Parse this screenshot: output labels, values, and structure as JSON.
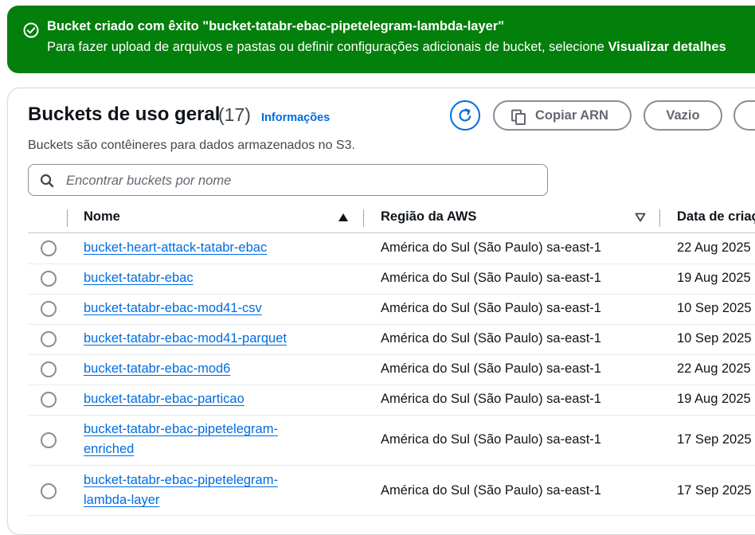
{
  "flash": {
    "title": "Bucket criado com êxito \"bucket-tatabr-ebac-pipetelegram-lambda-layer\"",
    "body_prefix": "Para fazer upload de arquivos e pastas ou definir configurações adicionais de bucket, selecione ",
    "body_bold": "Visualizar detalhes",
    "icon": "check-circle-icon",
    "color": "#037f0c"
  },
  "header": {
    "title": "Buckets de uso geral",
    "count": "(17)",
    "info_link": "Informações",
    "description": "Buckets são contêineres para dados armazenados no S3."
  },
  "actions": {
    "refresh_icon": "refresh-icon",
    "copy_arn": "Copiar ARN",
    "copy_icon": "copy-icon",
    "empty": "Vazio"
  },
  "search": {
    "placeholder": "Encontrar buckets por nome",
    "value": ""
  },
  "table": {
    "columns": [
      "Nome",
      "Região da AWS",
      "Data de criação"
    ],
    "rows": [
      {
        "name": "bucket-heart-attack-tatabr-ebac",
        "region": "América do Sul (São Paulo) sa-east-1",
        "date": "22 Aug 2025"
      },
      {
        "name": "bucket-tatabr-ebac",
        "region": "América do Sul (São Paulo) sa-east-1",
        "date": "19 Aug 2025"
      },
      {
        "name": "bucket-tatabr-ebac-mod41-csv",
        "region": "América do Sul (São Paulo) sa-east-1",
        "date": "10 Sep 2025"
      },
      {
        "name": "bucket-tatabr-ebac-mod41-parquet",
        "region": "América do Sul (São Paulo) sa-east-1",
        "date": "10 Sep 2025"
      },
      {
        "name": "bucket-tatabr-ebac-mod6",
        "region": "América do Sul (São Paulo) sa-east-1",
        "date": "22 Aug 2025"
      },
      {
        "name": "bucket-tatabr-ebac-particao",
        "region": "América do Sul (São Paulo) sa-east-1",
        "date": "19 Aug 2025"
      },
      {
        "name": "bucket-tatabr-ebac-pipetelegram-enriched",
        "region": "América do Sul (São Paulo) sa-east-1",
        "date": "17 Sep 2025"
      },
      {
        "name": "bucket-tatabr-ebac-pipetelegram-lambda-layer",
        "region": "América do Sul (São Paulo) sa-east-1",
        "date": "17 Sep 2025"
      }
    ]
  },
  "colors": {
    "link": "#006ce0",
    "text": "#0f141a",
    "muted": "#424650"
  }
}
